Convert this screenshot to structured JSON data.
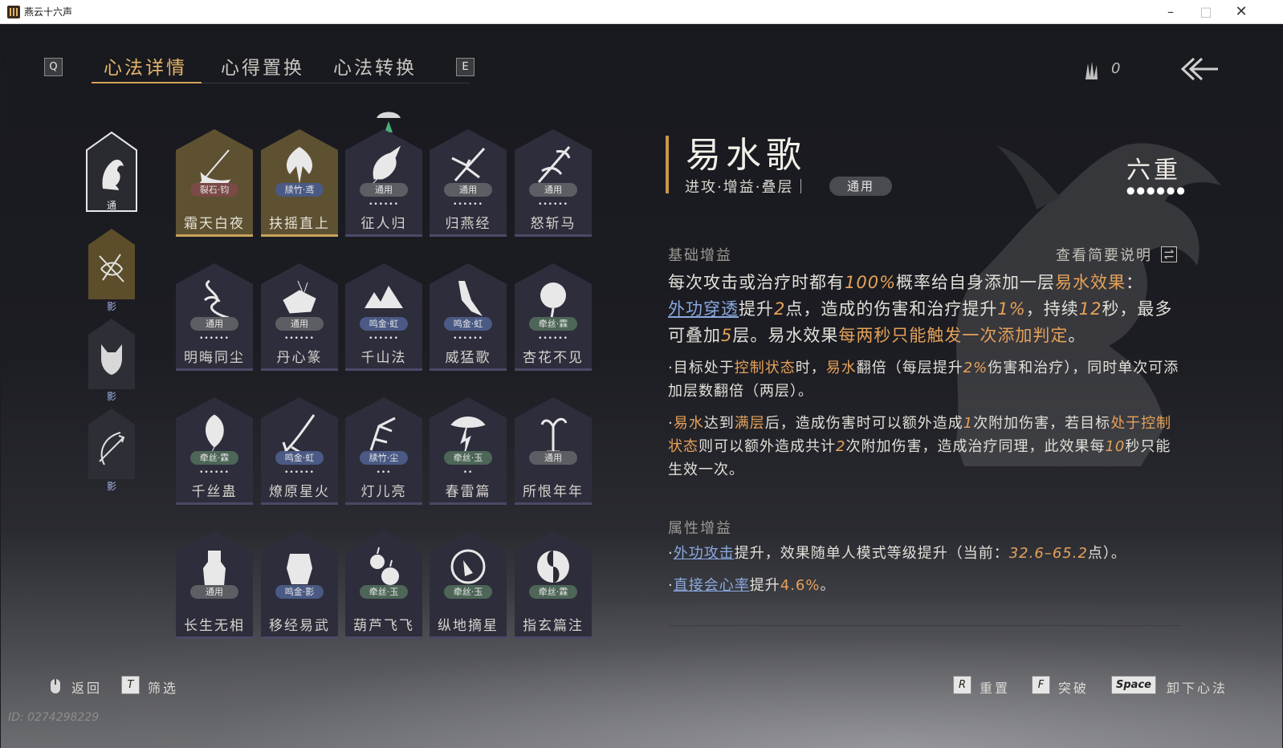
{
  "window": {
    "title": "燕云十六声"
  },
  "tabs": {
    "prev_key": "Q",
    "next_key": "E",
    "items": [
      "心法详情",
      "心得置换",
      "心法转换"
    ]
  },
  "currency": {
    "count": "0"
  },
  "schools": [
    "通",
    "影",
    "影",
    "影"
  ],
  "grid": [
    {
      "name": "霜天白夜",
      "tag": "裂石·钧",
      "dots": "",
      "style": "gold",
      "tagc": "r"
    },
    {
      "name": "扶摇直上",
      "tag": "牍竹·鸢",
      "dots": "",
      "style": "gold",
      "tagc": "b"
    },
    {
      "name": "征人归",
      "tag": "通用",
      "dots": "••••••",
      "style": "dark",
      "tagc": "g"
    },
    {
      "name": "归燕经",
      "tag": "通用",
      "dots": "••••••",
      "style": "dark",
      "tagc": "g"
    },
    {
      "name": "怒斩马",
      "tag": "通用",
      "dots": "••••••",
      "style": "dark",
      "tagc": "g"
    },
    {
      "name": "明晦同尘",
      "tag": "通用",
      "dots": "••••••",
      "style": "dark",
      "tagc": "g"
    },
    {
      "name": "丹心篆",
      "tag": "通用",
      "dots": "••••••",
      "style": "dark",
      "tagc": "g"
    },
    {
      "name": "千山法",
      "tag": "鸣金·虹",
      "dots": "••••••",
      "style": "dark",
      "tagc": "b"
    },
    {
      "name": "威猛歌",
      "tag": "鸣金·虹",
      "dots": "••••••",
      "style": "dark",
      "tagc": "b"
    },
    {
      "name": "杏花不见",
      "tag": "牵丝·霖",
      "dots": "••••••",
      "style": "dark",
      "tagc": "gr"
    },
    {
      "name": "千丝蛊",
      "tag": "牵丝·霖",
      "dots": "••••••",
      "style": "dark",
      "tagc": "gr"
    },
    {
      "name": "燎原星火",
      "tag": "鸣金·虹",
      "dots": "••••••",
      "style": "dark",
      "tagc": "b"
    },
    {
      "name": "灯儿亮",
      "tag": "牍竹·尘",
      "dots": "•••",
      "style": "dark",
      "tagc": "b"
    },
    {
      "name": "春雷篇",
      "tag": "牵丝·玉",
      "dots": "••",
      "style": "dark",
      "tagc": "gr"
    },
    {
      "name": "所恨年年",
      "tag": "通用",
      "dots": "",
      "style": "dark",
      "tagc": "g"
    },
    {
      "name": "长生无相",
      "tag": "通用",
      "dots": "",
      "style": "dark",
      "tagc": "g"
    },
    {
      "name": "移经易武",
      "tag": "鸣金·影",
      "dots": "",
      "style": "dark",
      "tagc": "b"
    },
    {
      "name": "葫芦飞飞",
      "tag": "牵丝·玉",
      "dots": "",
      "style": "dark",
      "tagc": "gr"
    },
    {
      "name": "纵地摘星",
      "tag": "牵丝·玉",
      "dots": "",
      "style": "dark",
      "tagc": "gr"
    },
    {
      "name": "指玄篇注",
      "tag": "牵丝·霖",
      "dots": "",
      "style": "dark",
      "tagc": "gr"
    }
  ],
  "detail": {
    "title": "易水歌",
    "subtitle": "进攻·增益·叠层｜",
    "pill": "通用",
    "rank": "六重",
    "rank_dots": "●●●●●●",
    "base_label": "基础增益",
    "brief_label": "查看简要说明",
    "attr_label": "属性增益",
    "p1": {
      "a": "每次攻击或治疗时都有",
      "b": "100%",
      "c": "概率给自身添加一层",
      "d": "易水效果",
      "e": "：",
      "f": "外功穿透",
      "g": "提升",
      "h": "2",
      "i": "点，造成的伤害和治疗提升",
      "j": "1%",
      "k": "，持续",
      "l": "12",
      "m": "秒，最多可叠加",
      "n": "5",
      "o": "层。易水效果",
      "p": "每两秒只能触发一次添加判定",
      "q": "。"
    },
    "p2": {
      "a": "·目标处于",
      "b": "控制状态",
      "c": "时，",
      "d": "易水",
      "e": "翻倍（每层提升",
      "f": "2%",
      "g": "伤害和治疗），同时单次可添加层数翻倍（两层）。"
    },
    "p3": {
      "a": "·",
      "b": "易水",
      "c": "达到",
      "d": "满层",
      "e": "后，造成伤害时可以额外造成",
      "f": "1",
      "g": "次附加伤害，若目标",
      "h": "处于控制状态",
      "i": "则可以额外造成共计",
      "j": "2",
      "k": "次附加伤害，造成治疗同理，此效果每",
      "l": "10",
      "m": "秒只能生效一次。"
    },
    "p4": {
      "a": "·",
      "b": "外功攻击",
      "c": "提升，效果随单人模式等级提升（当前：",
      "d": "32.6–65.2",
      "e": "点）。"
    },
    "p5": {
      "a": "·",
      "b": "直接会心率",
      "c": "提升",
      "d": "4.6%",
      "e": "。"
    }
  },
  "footer": {
    "back": "返回",
    "filter_key": "T",
    "filter": "筛选",
    "reset_key": "R",
    "reset": "重置",
    "break_key": "F",
    "break": "突破",
    "unload_key": "Space",
    "unload": "卸下心法"
  },
  "id_text": "ID: 0274298229",
  "colors": {
    "accent": "#e6b56a",
    "highlight": "#e6a158",
    "link": "#8aa8e0"
  }
}
